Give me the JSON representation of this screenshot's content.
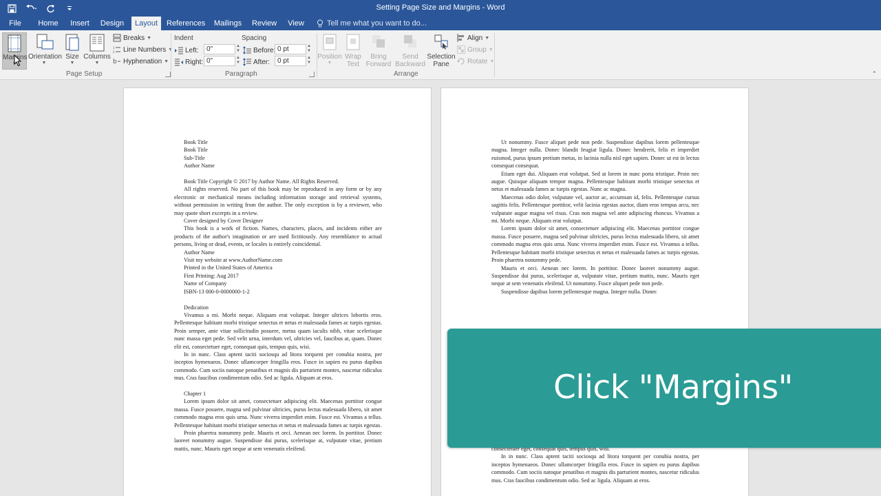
{
  "window": {
    "title": "Setting Page Size and Margins - Word"
  },
  "qat": {
    "save": "save-icon",
    "undo": "undo-icon",
    "redo": "redo-icon",
    "customize": "customize-icon"
  },
  "tabs": [
    "File",
    "Home",
    "Insert",
    "Design",
    "Layout",
    "References",
    "Mailings",
    "Review",
    "View"
  ],
  "tell_me": "Tell me what you want to do...",
  "ribbon": {
    "page_setup": {
      "label": "Page Setup",
      "margins": "Margins",
      "orientation": "Orientation",
      "size": "Size",
      "columns": "Columns",
      "breaks": "Breaks",
      "line_numbers": "Line Numbers",
      "hyphenation": "Hyphenation"
    },
    "paragraph": {
      "label": "Paragraph",
      "indent": "Indent",
      "spacing": "Spacing",
      "left": "Left:",
      "right": "Right:",
      "before": "Before:",
      "after": "After:",
      "left_val": "0\"",
      "right_val": "0\"",
      "before_val": "0 pt",
      "after_val": "0 pt"
    },
    "arrange": {
      "label": "Arrange",
      "position_1": "Position",
      "wrap_1": "Wrap",
      "wrap_2": "Text",
      "bring_1": "Bring",
      "bring_2": "Forward",
      "send_1": "Send",
      "send_2": "Backward",
      "selection_1": "Selection",
      "selection_2": "Pane",
      "align": "Align",
      "group": "Group",
      "rotate": "Rotate"
    }
  },
  "page1": {
    "t1": "Book Title",
    "t2": "Book Title",
    "t3": "Sub-Title",
    "t4": "Author Name",
    "t5": "Book Title Copyright © 2017 by Author Name. All Rights Reserved.",
    "t6": "All rights reserved. No part of this book may be reproduced in any form or by any electronic or mechanical means including information storage and retrieval systems, without permission in writing from the author. The only exception is by a reviewer, who may quote short excerpts in a review.",
    "t7": "Cover designed by Cover Designer",
    "t8": "This book is a work of fiction. Names, characters, places, and incidents either are products of the author's imagination or are used fictitiously. Any resemblance to actual persons, living or dead, events, or locales is entirely coincidental.",
    "t9": "Author Name",
    "t10": "Visit my website at www.AuthorName.com",
    "t11": "Printed in the United States of America",
    "t12": "First Printing: Aug 2017",
    "t13": "Name of Company",
    "t14": "ISBN-13 000-0-0000000-1-2",
    "t15": "Dedication",
    "t16": "Vivamus a mi. Morbi neque. Aliquam erat volutpat. Integer ultrices lobortis eros. Pellentesque habitant morbi tristique senectus et netus et malesuada fames ac turpis egestas. Proin semper, ante vitae sollicitudin posuere, metus quam iaculis nibh, vitae scelerisque nunc massa eget pede. Sed velit urna, interdum vel, ultricies vel, faucibus at, quam. Donec elit est, consectetuer eget, consequat quis, tempus quis, wisi.",
    "t17": "In in nunc. Class aptent taciti sociosqu ad litora torquent per conubia nostra, per inceptos hymenaeos. Donec ullamcorper fringilla eros. Fusce in sapien eu purus dapibus commodo. Cum sociis natoque penatibus et magnis dis parturient montes, nascetur ridiculus mus. Cras faucibus condimentum odio. Sed ac ligula. Aliquam at eros.",
    "t18": "Chapter 1",
    "t19": "Lorem ipsum dolor sit amet, consectetuer adipiscing elit. Maecenas porttitor congue massa. Fusce posuere, magna sed pulvinar ultricies, purus lectus malesuada libero, sit amet commodo magna eros quis urna. Nunc viverra imperdiet enim. Fusce est. Vivamus a tellus. Pellentesque habitant morbi tristique senectus et netus et malesuada fames ac turpis egestas.",
    "t20": "Proin pharetra nonummy pede. Mauris et orci. Aenean nec lorem. In porttitor. Donec laoreet nonummy augue. Suspendisse dui purus, scelerisque at, vulputate vitae, pretium mattis, nunc. Mauris eget neque at sem venenatis eleifend."
  },
  "page2": {
    "p1": "Ut nonummy. Fusce aliquet pede non pede. Suspendisse dapibus lorem pellentesque magna. Integer nulla. Donec blandit feugiat ligula. Donec hendrerit, felis et imperdiet euismod, purus ipsum pretium metus, in lacinia nulla nisl eget sapien. Donec ut est in lectus consequat consequat.",
    "p2": "Etiam eget dui. Aliquam erat volutpat. Sed at lorem in nunc porta tristique. Proin nec augue. Quisque aliquam tempor magna. Pellentesque habitant morbi tristique senectus et netus et malesuada fames ac turpis egestas. Nunc ac magna.",
    "p3": "Maecenas odio dolor, vulputate vel, auctor ac, accumsan id, felis. Pellentesque cursus sagittis felis. Pellentesque porttitor, velit lacinia egestas auctor, diam eros tempus arcu, nec vulputate augue magna vel risus. Cras non magna vel ante adipiscing rhoncus. Vivamus a mi. Morbi neque. Aliquam erat volutpat.",
    "p4": "Lorem ipsum dolor sit amet, consectetuer adipiscing elit. Maecenas porttitor congue massa. Fusce posuere, magna sed pulvinar ultricies, purus lectus malesuada libero, sit amet commodo magna eros quis urna. Nunc viverra imperdiet enim. Fusce est. Vivamus a tellus. Pellentesque habitant morbi tristique senectus et netus et malesuada fames ac turpis egestas. Proin pharetra nonummy pede.",
    "p5": "Mauris et orci. Aenean nec lorem. In porttitor. Donec laoreet nonummy augue. Suspendisse dui purus, scelerisque at, vulputate vitae, pretium mattis, nunc. Mauris eget neque at sem venenatis eleifend. Ut nonummy. Fusce aliquet pede non pede.",
    "p6": "Suspendisse dapibus lorem pellentesque magna. Integer nulla. Donec",
    "p7": "consectetuer eget, consequat quis, tempus quis, wisi.",
    "p8": "In in nunc. Class aptent taciti sociosqu ad litora torquent per conubia nostra, per inceptos hymenaeos. Donec ullamcorper fringilla eros. Fusce in sapien eu purus dapibus commodo. Cum sociis natoque penatibus et magnis dis parturient montes, nascetur ridiculus mus. Cras faucibus condimentum odio. Sed ac ligula. Aliquam at eros."
  },
  "overlay": {
    "text": "Click \"Margins\"",
    "color": "#2a9b95"
  },
  "colors": {
    "accent": "#2b579a",
    "ribbon": "#f1f1f1",
    "canvas": "#e6e6e6"
  }
}
